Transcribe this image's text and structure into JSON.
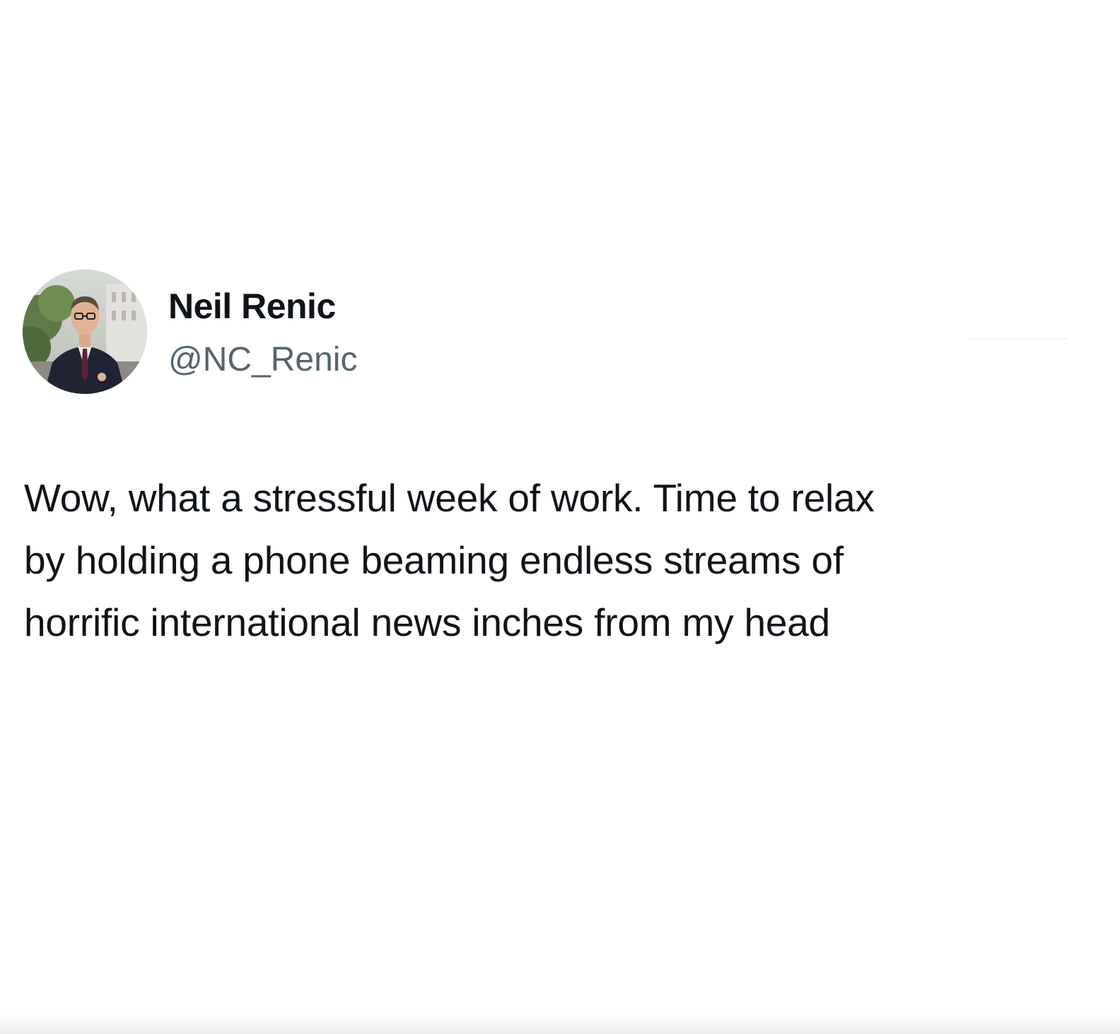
{
  "tweet": {
    "author": {
      "name": "Neil Renic",
      "handle": "@NC_Renic",
      "avatar_icon": "profile-photo"
    },
    "text_lines": [
      "Wow, what a stressful week of work. Time to relax",
      "by holding a phone beaming endless streams of",
      "horrific international news inches from my head"
    ]
  },
  "colors": {
    "background": "#ffffff",
    "name": "#0f1419",
    "handle": "#536471",
    "body_text": "#0f1419"
  }
}
